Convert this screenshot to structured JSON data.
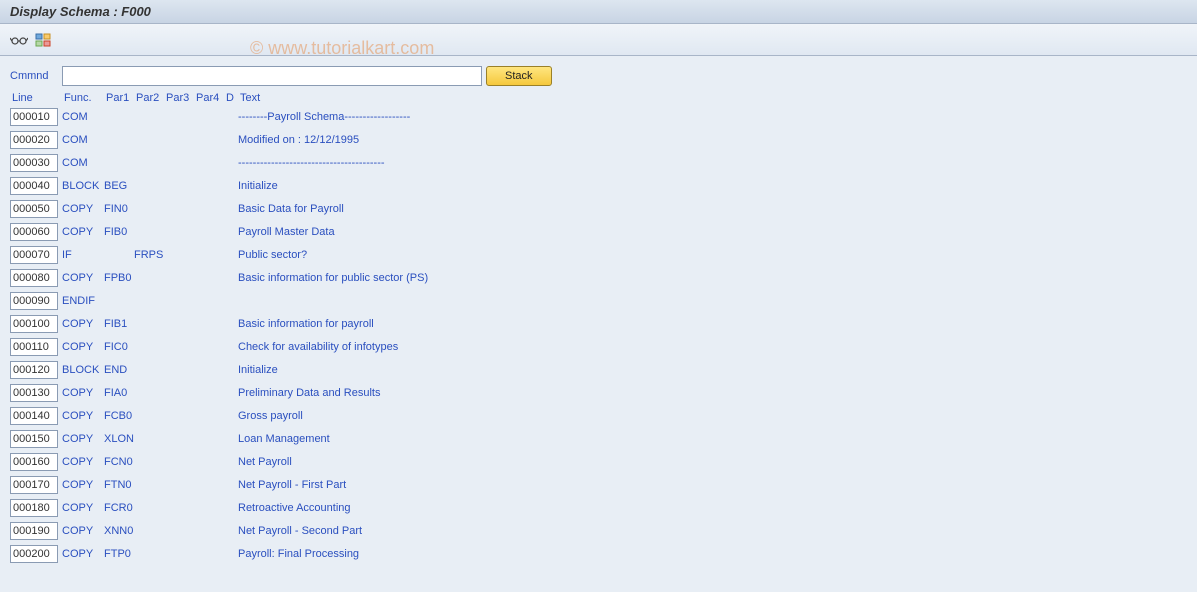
{
  "title": "Display Schema : F000",
  "watermark": "© www.tutorialkart.com",
  "command": {
    "label": "Cmmnd",
    "value": "",
    "stack_label": "Stack"
  },
  "headers": {
    "line": "Line",
    "func": "Func.",
    "par1": "Par1",
    "par2": "Par2",
    "par3": "Par3",
    "par4": "Par4",
    "d": "D",
    "text": "Text"
  },
  "rows": [
    {
      "line": "000010",
      "func": "COM",
      "par1": "",
      "par2": "",
      "par3": "",
      "par4": "",
      "d": "",
      "text": "--------Payroll Schema------------------"
    },
    {
      "line": "000020",
      "func": "COM",
      "par1": "",
      "par2": "",
      "par3": "",
      "par4": "",
      "d": "",
      "text": "Modified on  : 12/12/1995"
    },
    {
      "line": "000030",
      "func": "COM",
      "par1": "",
      "par2": "",
      "par3": "",
      "par4": "",
      "d": "",
      "text": "----------------------------------------"
    },
    {
      "line": "000040",
      "func": "BLOCK",
      "par1": "BEG",
      "par2": "",
      "par3": "",
      "par4": "",
      "d": "",
      "text": "Initialize"
    },
    {
      "line": "000050",
      "func": "COPY",
      "par1": "FIN0",
      "par2": "",
      "par3": "",
      "par4": "",
      "d": "",
      "text": "Basic Data for Payroll"
    },
    {
      "line": "000060",
      "func": "COPY",
      "par1": "FIB0",
      "par2": "",
      "par3": "",
      "par4": "",
      "d": "",
      "text": "Payroll Master Data"
    },
    {
      "line": "000070",
      "func": "IF",
      "par1": "",
      "par2": "FRPS",
      "par3": "",
      "par4": "",
      "d": "",
      "text": "Public sector?"
    },
    {
      "line": "000080",
      "func": "COPY",
      "par1": "FPB0",
      "par2": "",
      "par3": "",
      "par4": "",
      "d": "",
      "text": "Basic information for public sector (PS)"
    },
    {
      "line": "000090",
      "func": "ENDIF",
      "par1": "",
      "par2": "",
      "par3": "",
      "par4": "",
      "d": "",
      "text": ""
    },
    {
      "line": "000100",
      "func": "COPY",
      "par1": "FIB1",
      "par2": "",
      "par3": "",
      "par4": "",
      "d": "",
      "text": "Basic information for payroll"
    },
    {
      "line": "000110",
      "func": "COPY",
      "par1": "FIC0",
      "par2": "",
      "par3": "",
      "par4": "",
      "d": "",
      "text": "Check for availability of infotypes"
    },
    {
      "line": "000120",
      "func": "BLOCK",
      "par1": "END",
      "par2": "",
      "par3": "",
      "par4": "",
      "d": "",
      "text": "Initialize"
    },
    {
      "line": "000130",
      "func": "COPY",
      "par1": "FIA0",
      "par2": "",
      "par3": "",
      "par4": "",
      "d": "",
      "text": "Preliminary Data and Results"
    },
    {
      "line": "000140",
      "func": "COPY",
      "par1": "FCB0",
      "par2": "",
      "par3": "",
      "par4": "",
      "d": "",
      "text": "Gross payroll"
    },
    {
      "line": "000150",
      "func": "COPY",
      "par1": "XLON",
      "par2": "",
      "par3": "",
      "par4": "",
      "d": "",
      "text": "Loan Management"
    },
    {
      "line": "000160",
      "func": "COPY",
      "par1": "FCN0",
      "par2": "",
      "par3": "",
      "par4": "",
      "d": "",
      "text": "Net Payroll"
    },
    {
      "line": "000170",
      "func": "COPY",
      "par1": "FTN0",
      "par2": "",
      "par3": "",
      "par4": "",
      "d": "",
      "text": "Net Payroll - First Part"
    },
    {
      "line": "000180",
      "func": "COPY",
      "par1": "FCR0",
      "par2": "",
      "par3": "",
      "par4": "",
      "d": "",
      "text": "Retroactive Accounting"
    },
    {
      "line": "000190",
      "func": "COPY",
      "par1": "XNN0",
      "par2": "",
      "par3": "",
      "par4": "",
      "d": "",
      "text": "Net Payroll - Second Part"
    },
    {
      "line": "000200",
      "func": "COPY",
      "par1": "FTP0",
      "par2": "",
      "par3": "",
      "par4": "",
      "d": "",
      "text": "Payroll: Final Processing"
    }
  ]
}
